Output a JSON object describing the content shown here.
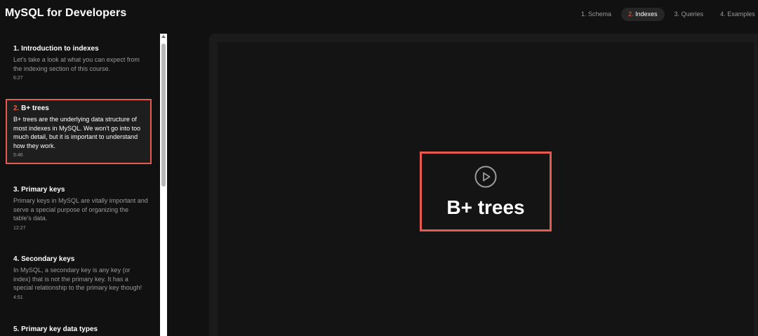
{
  "app": {
    "title": "MySQL for Developers"
  },
  "tabs": [
    {
      "num": "1.",
      "label": "Schema"
    },
    {
      "num": "2.",
      "label": "Indexes"
    },
    {
      "num": "3.",
      "label": "Queries"
    },
    {
      "num": "4.",
      "label": "Examples"
    }
  ],
  "lessons": [
    {
      "num": "1.",
      "title": "Introduction to indexes",
      "desc": "Let's take a look at what you can expect from the indexing section of this course.",
      "time": "6:27"
    },
    {
      "num": "2.",
      "title": "B+ trees",
      "desc": "B+ trees are the underlying data structure of most indexes in MySQL. We won't go into too much detail, but it is important to understand how they work.",
      "time": "5:46"
    },
    {
      "num": "3.",
      "title": "Primary keys",
      "desc": "Primary keys in MySQL are vitally important and serve a special purpose of organizing the table's data.",
      "time": "12:27"
    },
    {
      "num": "4.",
      "title": "Secondary keys",
      "desc": "In MySQL, a secondary key is any key (or index) that is not the primary key. It has a special relationship to the primary key though!",
      "time": "4:51"
    },
    {
      "num": "5.",
      "title": "Primary key data types",
      "desc": "",
      "time": ""
    }
  ],
  "video": {
    "title": "B+ trees",
    "icon": "play-icon"
  },
  "colors": {
    "accent": "#f0603e",
    "highlight_border": "#e85a50",
    "background": "#111111"
  }
}
